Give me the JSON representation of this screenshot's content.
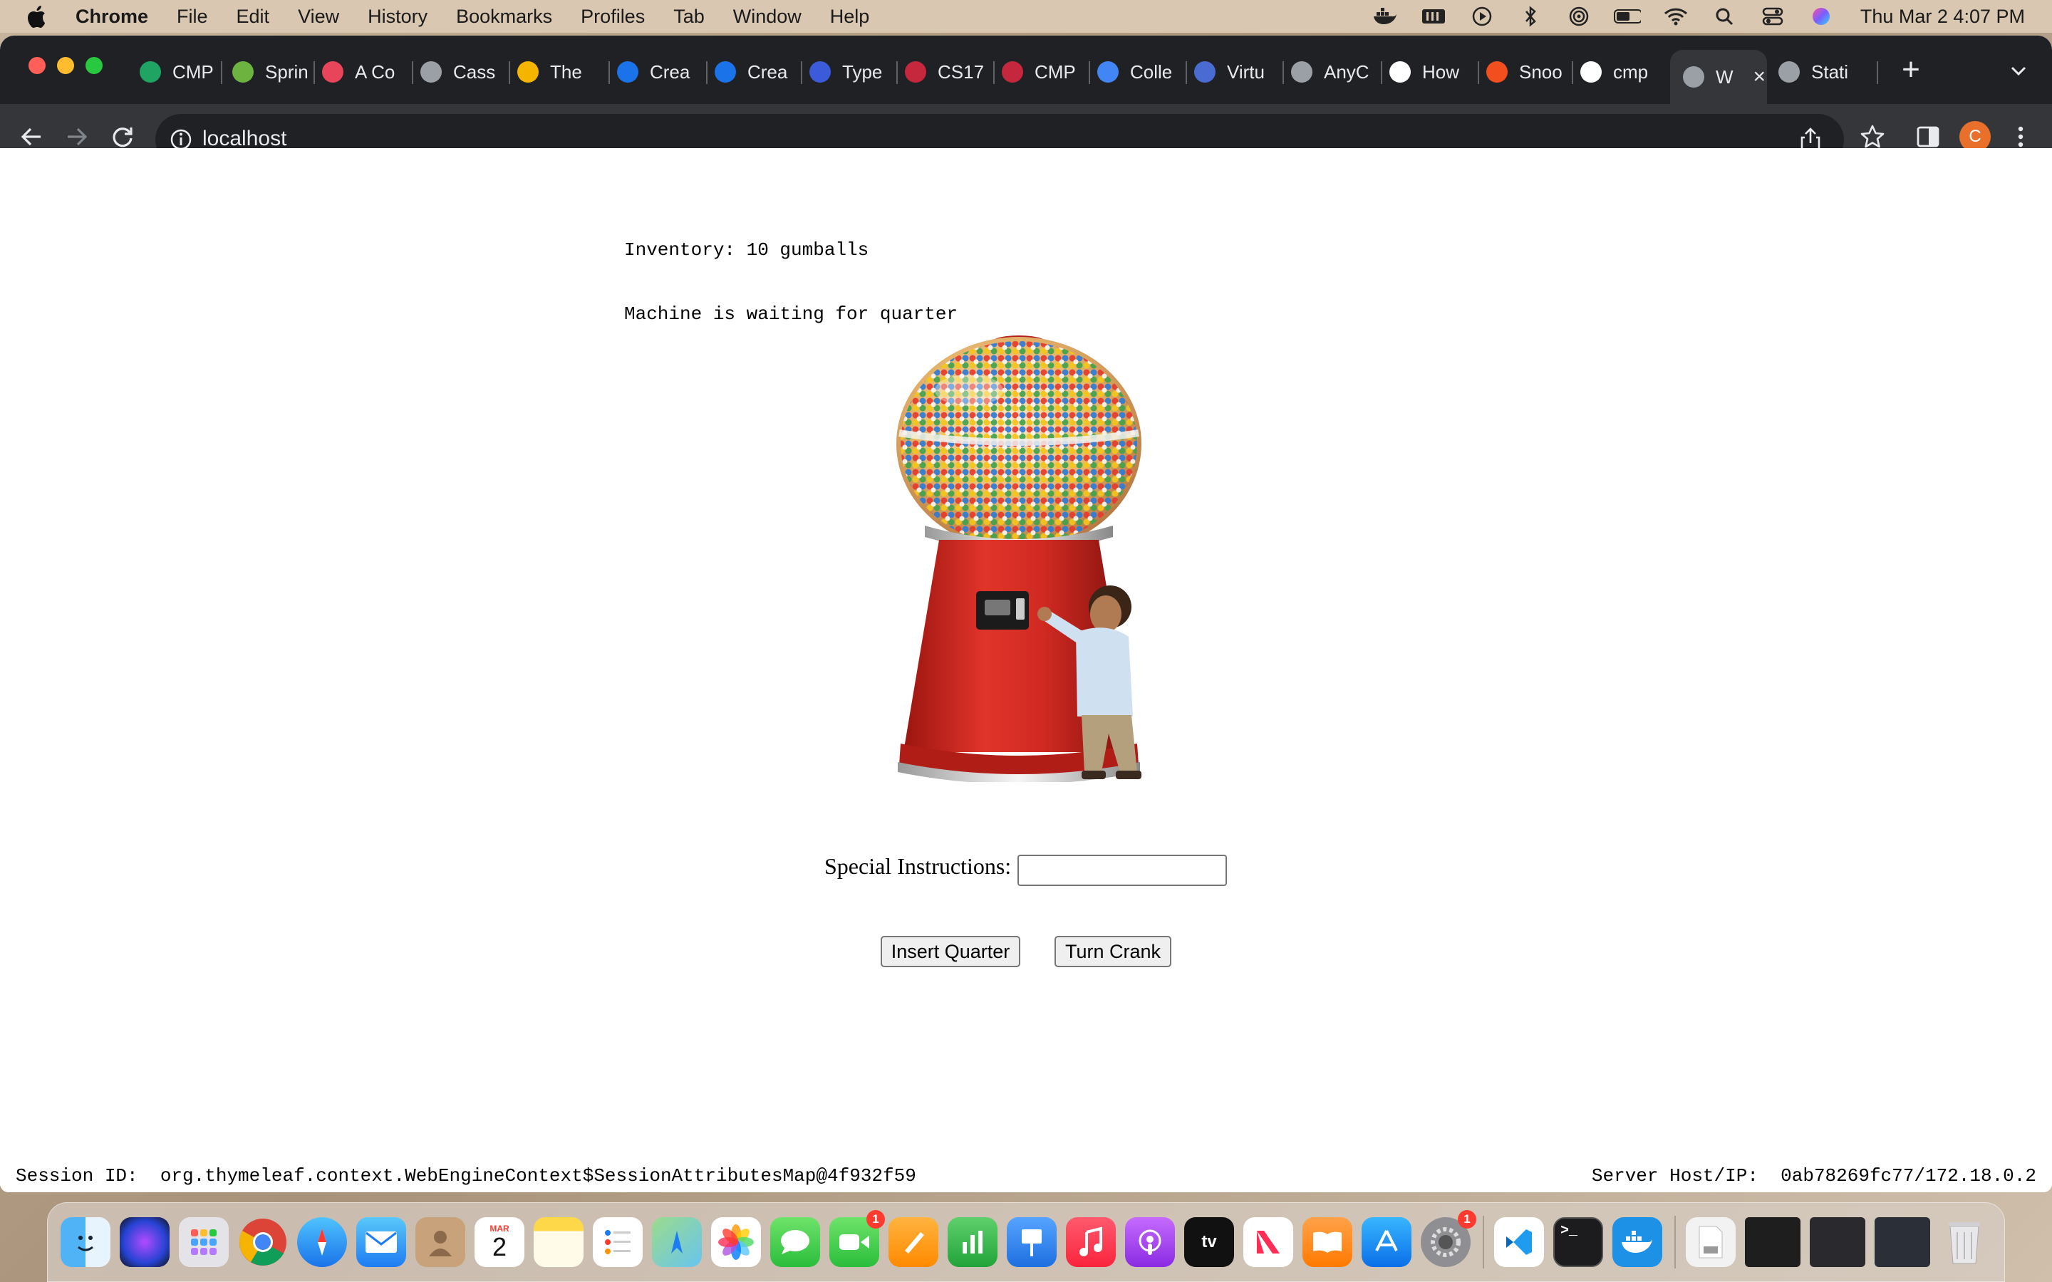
{
  "menubar": {
    "app": "Chrome",
    "menus": [
      "File",
      "Edit",
      "View",
      "History",
      "Bookmarks",
      "Profiles",
      "Tab",
      "Window",
      "Help"
    ],
    "clock": "Thu Mar 2  4:07 PM",
    "status_icons": [
      "docker-icon",
      "memory-icon",
      "play-icon",
      "bluetooth-icon",
      "airdrop-icon",
      "battery-icon",
      "wifi-icon",
      "spotlight-icon",
      "control-center-icon",
      "siri-icon"
    ]
  },
  "tabs": [
    {
      "label": "CMP",
      "icon": "google-drive-icon",
      "color": "#1fa463"
    },
    {
      "label": "Sprin",
      "icon": "spring-icon",
      "color": "#6db33f"
    },
    {
      "label": "A Co",
      "icon": "asterisk-icon",
      "color": "#e8445a"
    },
    {
      "label": "Cass",
      "icon": "globe-icon",
      "color": "#9aa0a6"
    },
    {
      "label": "The",
      "icon": "slides-icon",
      "color": "#f4b400"
    },
    {
      "label": "Crea",
      "icon": "c-icon",
      "color": "#1a73e8"
    },
    {
      "label": "Crea",
      "icon": "c-icon",
      "color": "#1a73e8"
    },
    {
      "label": "Type",
      "icon": "ux-icon",
      "color": "#3b5bdb"
    },
    {
      "label": "CS17",
      "icon": "gear-red-icon",
      "color": "#c5283d"
    },
    {
      "label": "CMP",
      "icon": "gear-red-icon",
      "color": "#c5283d"
    },
    {
      "label": "Colle",
      "icon": "bulb-icon",
      "color": "#4285f4"
    },
    {
      "label": "Virtu",
      "icon": "spartan-icon",
      "color": "#4a6bd1"
    },
    {
      "label": "AnyC",
      "icon": "globe-icon",
      "color": "#9aa0a6"
    },
    {
      "label": "How",
      "icon": "ring-icon",
      "color": "#ffffff"
    },
    {
      "label": "Snoo",
      "icon": "figma-icon",
      "color": "#f24e1e"
    },
    {
      "label": "cmp",
      "icon": "github-icon",
      "color": "#ffffff"
    },
    {
      "label": "W",
      "icon": "globe-icon",
      "color": "#9aa0a6",
      "active": true
    },
    {
      "label": "Stati",
      "icon": "globe-icon",
      "color": "#9aa0a6"
    }
  ],
  "address": {
    "url": "localhost"
  },
  "avatar": {
    "initial": "C"
  },
  "page": {
    "inventory": "Inventory: 10 gumballs",
    "state": "Machine is waiting for quarter",
    "special_label": "Special Instructions:",
    "special_value": "",
    "insert_btn": "Insert Quarter",
    "crank_btn": "Turn Crank",
    "session": "Session ID:  org.thymeleaf.context.WebEngineContext$SessionAttributesMap@4f932f59",
    "server": "Server Host/IP:  0ab78269fc77/172.18.0.2"
  },
  "dock": {
    "calendar_month": "MAR",
    "calendar_day": "2",
    "apps": [
      "finder",
      "siri",
      "launchpad",
      "chrome",
      "safari",
      "mail",
      "contacts",
      "calendar",
      "notes",
      "reminders",
      "maps",
      "photos",
      "messages",
      "facetime",
      "pages",
      "numbers",
      "keynote",
      "music",
      "podcasts",
      "apple-tv",
      "news",
      "books",
      "app-store",
      "system-preferences",
      "vscode",
      "terminal",
      "docker"
    ]
  }
}
